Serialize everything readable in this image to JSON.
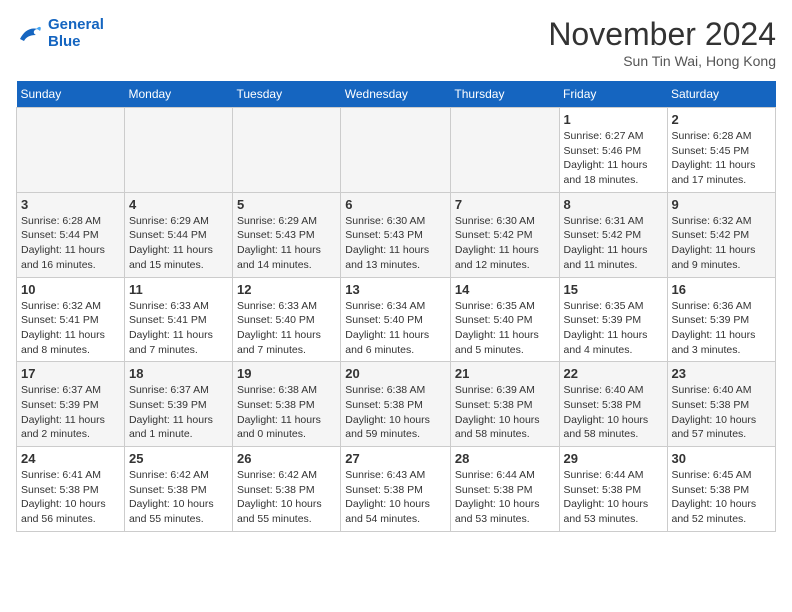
{
  "header": {
    "logo_line1": "General",
    "logo_line2": "Blue",
    "month": "November 2024",
    "location": "Sun Tin Wai, Hong Kong"
  },
  "days_of_week": [
    "Sunday",
    "Monday",
    "Tuesday",
    "Wednesday",
    "Thursday",
    "Friday",
    "Saturday"
  ],
  "weeks": [
    [
      {
        "day": "",
        "empty": true
      },
      {
        "day": "",
        "empty": true
      },
      {
        "day": "",
        "empty": true
      },
      {
        "day": "",
        "empty": true
      },
      {
        "day": "",
        "empty": true
      },
      {
        "day": "1",
        "sunrise": "Sunrise: 6:27 AM",
        "sunset": "Sunset: 5:46 PM",
        "daylight": "Daylight: 11 hours and 18 minutes."
      },
      {
        "day": "2",
        "sunrise": "Sunrise: 6:28 AM",
        "sunset": "Sunset: 5:45 PM",
        "daylight": "Daylight: 11 hours and 17 minutes."
      }
    ],
    [
      {
        "day": "3",
        "sunrise": "Sunrise: 6:28 AM",
        "sunset": "Sunset: 5:44 PM",
        "daylight": "Daylight: 11 hours and 16 minutes."
      },
      {
        "day": "4",
        "sunrise": "Sunrise: 6:29 AM",
        "sunset": "Sunset: 5:44 PM",
        "daylight": "Daylight: 11 hours and 15 minutes."
      },
      {
        "day": "5",
        "sunrise": "Sunrise: 6:29 AM",
        "sunset": "Sunset: 5:43 PM",
        "daylight": "Daylight: 11 hours and 14 minutes."
      },
      {
        "day": "6",
        "sunrise": "Sunrise: 6:30 AM",
        "sunset": "Sunset: 5:43 PM",
        "daylight": "Daylight: 11 hours and 13 minutes."
      },
      {
        "day": "7",
        "sunrise": "Sunrise: 6:30 AM",
        "sunset": "Sunset: 5:42 PM",
        "daylight": "Daylight: 11 hours and 12 minutes."
      },
      {
        "day": "8",
        "sunrise": "Sunrise: 6:31 AM",
        "sunset": "Sunset: 5:42 PM",
        "daylight": "Daylight: 11 hours and 11 minutes."
      },
      {
        "day": "9",
        "sunrise": "Sunrise: 6:32 AM",
        "sunset": "Sunset: 5:42 PM",
        "daylight": "Daylight: 11 hours and 9 minutes."
      }
    ],
    [
      {
        "day": "10",
        "sunrise": "Sunrise: 6:32 AM",
        "sunset": "Sunset: 5:41 PM",
        "daylight": "Daylight: 11 hours and 8 minutes."
      },
      {
        "day": "11",
        "sunrise": "Sunrise: 6:33 AM",
        "sunset": "Sunset: 5:41 PM",
        "daylight": "Daylight: 11 hours and 7 minutes."
      },
      {
        "day": "12",
        "sunrise": "Sunrise: 6:33 AM",
        "sunset": "Sunset: 5:40 PM",
        "daylight": "Daylight: 11 hours and 7 minutes."
      },
      {
        "day": "13",
        "sunrise": "Sunrise: 6:34 AM",
        "sunset": "Sunset: 5:40 PM",
        "daylight": "Daylight: 11 hours and 6 minutes."
      },
      {
        "day": "14",
        "sunrise": "Sunrise: 6:35 AM",
        "sunset": "Sunset: 5:40 PM",
        "daylight": "Daylight: 11 hours and 5 minutes."
      },
      {
        "day": "15",
        "sunrise": "Sunrise: 6:35 AM",
        "sunset": "Sunset: 5:39 PM",
        "daylight": "Daylight: 11 hours and 4 minutes."
      },
      {
        "day": "16",
        "sunrise": "Sunrise: 6:36 AM",
        "sunset": "Sunset: 5:39 PM",
        "daylight": "Daylight: 11 hours and 3 minutes."
      }
    ],
    [
      {
        "day": "17",
        "sunrise": "Sunrise: 6:37 AM",
        "sunset": "Sunset: 5:39 PM",
        "daylight": "Daylight: 11 hours and 2 minutes."
      },
      {
        "day": "18",
        "sunrise": "Sunrise: 6:37 AM",
        "sunset": "Sunset: 5:39 PM",
        "daylight": "Daylight: 11 hours and 1 minute."
      },
      {
        "day": "19",
        "sunrise": "Sunrise: 6:38 AM",
        "sunset": "Sunset: 5:38 PM",
        "daylight": "Daylight: 11 hours and 0 minutes."
      },
      {
        "day": "20",
        "sunrise": "Sunrise: 6:38 AM",
        "sunset": "Sunset: 5:38 PM",
        "daylight": "Daylight: 10 hours and 59 minutes."
      },
      {
        "day": "21",
        "sunrise": "Sunrise: 6:39 AM",
        "sunset": "Sunset: 5:38 PM",
        "daylight": "Daylight: 10 hours and 58 minutes."
      },
      {
        "day": "22",
        "sunrise": "Sunrise: 6:40 AM",
        "sunset": "Sunset: 5:38 PM",
        "daylight": "Daylight: 10 hours and 58 minutes."
      },
      {
        "day": "23",
        "sunrise": "Sunrise: 6:40 AM",
        "sunset": "Sunset: 5:38 PM",
        "daylight": "Daylight: 10 hours and 57 minutes."
      }
    ],
    [
      {
        "day": "24",
        "sunrise": "Sunrise: 6:41 AM",
        "sunset": "Sunset: 5:38 PM",
        "daylight": "Daylight: 10 hours and 56 minutes."
      },
      {
        "day": "25",
        "sunrise": "Sunrise: 6:42 AM",
        "sunset": "Sunset: 5:38 PM",
        "daylight": "Daylight: 10 hours and 55 minutes."
      },
      {
        "day": "26",
        "sunrise": "Sunrise: 6:42 AM",
        "sunset": "Sunset: 5:38 PM",
        "daylight": "Daylight: 10 hours and 55 minutes."
      },
      {
        "day": "27",
        "sunrise": "Sunrise: 6:43 AM",
        "sunset": "Sunset: 5:38 PM",
        "daylight": "Daylight: 10 hours and 54 minutes."
      },
      {
        "day": "28",
        "sunrise": "Sunrise: 6:44 AM",
        "sunset": "Sunset: 5:38 PM",
        "daylight": "Daylight: 10 hours and 53 minutes."
      },
      {
        "day": "29",
        "sunrise": "Sunrise: 6:44 AM",
        "sunset": "Sunset: 5:38 PM",
        "daylight": "Daylight: 10 hours and 53 minutes."
      },
      {
        "day": "30",
        "sunrise": "Sunrise: 6:45 AM",
        "sunset": "Sunset: 5:38 PM",
        "daylight": "Daylight: 10 hours and 52 minutes."
      }
    ]
  ]
}
